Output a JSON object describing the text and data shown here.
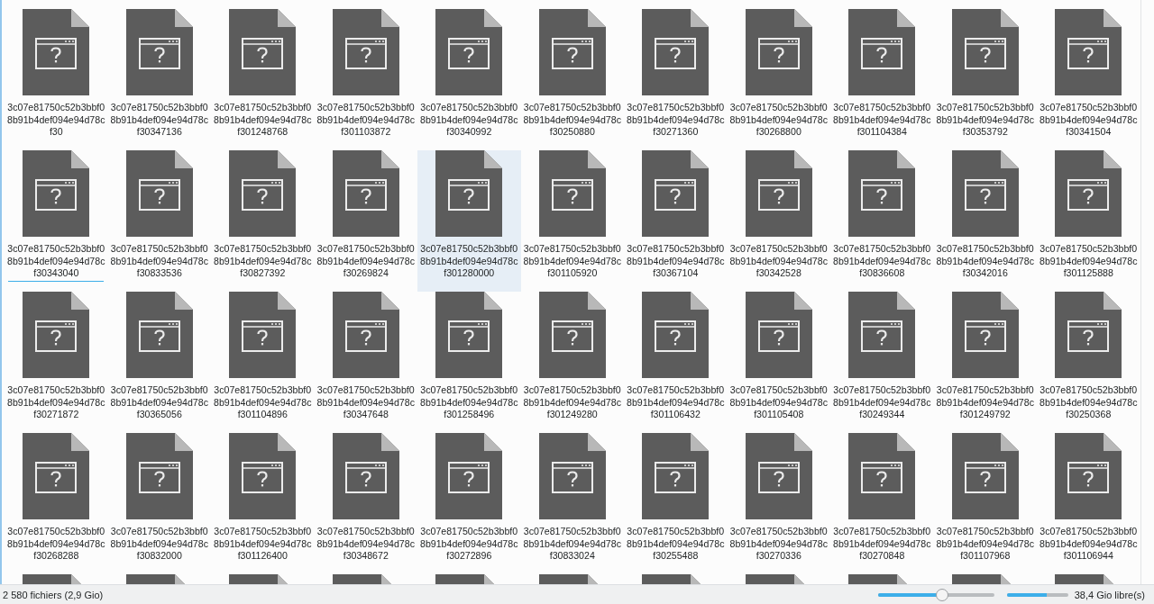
{
  "files": [
    {
      "kind": "file",
      "lines": [
        "3c07e81750c52b3bbf0",
        "8b91b4def094e94d78c",
        "f30"
      ],
      "focused": false,
      "hovered": false
    },
    {
      "kind": "file",
      "lines": [
        "3c07e81750c52b3bbf0",
        "8b91b4def094e94d78c",
        "f30347136"
      ],
      "focused": false,
      "hovered": false
    },
    {
      "kind": "file",
      "lines": [
        "3c07e81750c52b3bbf0",
        "8b91b4def094e94d78c",
        "f301248768"
      ],
      "focused": false,
      "hovered": false
    },
    {
      "kind": "file",
      "lines": [
        "3c07e81750c52b3bbf0",
        "8b91b4def094e94d78c",
        "f301103872"
      ],
      "focused": false,
      "hovered": false
    },
    {
      "kind": "file",
      "lines": [
        "3c07e81750c52b3bbf0",
        "8b91b4def094e94d78c",
        "f30340992"
      ],
      "focused": false,
      "hovered": false
    },
    {
      "kind": "file",
      "lines": [
        "3c07e81750c52b3bbf0",
        "8b91b4def094e94d78c",
        "f30250880"
      ],
      "focused": false,
      "hovered": false
    },
    {
      "kind": "file",
      "lines": [
        "3c07e81750c52b3bbf0",
        "8b91b4def094e94d78c",
        "f30271360"
      ],
      "focused": false,
      "hovered": false
    },
    {
      "kind": "file",
      "lines": [
        "3c07e81750c52b3bbf0",
        "8b91b4def094e94d78c",
        "f30268800"
      ],
      "focused": false,
      "hovered": false
    },
    {
      "kind": "file",
      "lines": [
        "3c07e81750c52b3bbf0",
        "8b91b4def094e94d78c",
        "f301104384"
      ],
      "focused": false,
      "hovered": false
    },
    {
      "kind": "file",
      "lines": [
        "3c07e81750c52b3bbf0",
        "8b91b4def094e94d78c",
        "f30353792"
      ],
      "focused": false,
      "hovered": false
    },
    {
      "kind": "file",
      "lines": [
        "3c07e81750c52b3bbf0",
        "8b91b4def094e94d78c",
        "f30341504"
      ],
      "focused": false,
      "hovered": false
    },
    {
      "kind": "file",
      "lines": [
        "3c07e81750c52b3bbf0",
        "8b91b4def094e94d78c",
        "f30343040"
      ],
      "focused": true,
      "hovered": false
    },
    {
      "kind": "file",
      "lines": [
        "3c07e81750c52b3bbf0",
        "8b91b4def094e94d78c",
        "f30833536"
      ],
      "focused": false,
      "hovered": false
    },
    {
      "kind": "file",
      "lines": [
        "3c07e81750c52b3bbf0",
        "8b91b4def094e94d78c",
        "f30827392"
      ],
      "focused": false,
      "hovered": false
    },
    {
      "kind": "file",
      "lines": [
        "3c07e81750c52b3bbf0",
        "8b91b4def094e94d78c",
        "f30269824"
      ],
      "focused": false,
      "hovered": false
    },
    {
      "kind": "file",
      "lines": [
        "3c07e81750c52b3bbf0",
        "8b91b4def094e94d78c",
        "f301280000"
      ],
      "focused": false,
      "hovered": true
    },
    {
      "kind": "file",
      "lines": [
        "3c07e81750c52b3bbf0",
        "8b91b4def094e94d78c",
        "f301105920"
      ],
      "focused": false,
      "hovered": false
    },
    {
      "kind": "file",
      "lines": [
        "3c07e81750c52b3bbf0",
        "8b91b4def094e94d78c",
        "f30367104"
      ],
      "focused": false,
      "hovered": false
    },
    {
      "kind": "file",
      "lines": [
        "3c07e81750c52b3bbf0",
        "8b91b4def094e94d78c",
        "f30342528"
      ],
      "focused": false,
      "hovered": false
    },
    {
      "kind": "file",
      "lines": [
        "3c07e81750c52b3bbf0",
        "8b91b4def094e94d78c",
        "f30836608"
      ],
      "focused": false,
      "hovered": false
    },
    {
      "kind": "file",
      "lines": [
        "3c07e81750c52b3bbf0",
        "8b91b4def094e94d78c",
        "f30342016"
      ],
      "focused": false,
      "hovered": false
    },
    {
      "kind": "file",
      "lines": [
        "3c07e81750c52b3bbf0",
        "8b91b4def094e94d78c",
        "f301125888"
      ],
      "focused": false,
      "hovered": false
    },
    {
      "kind": "file",
      "lines": [
        "3c07e81750c52b3bbf0",
        "8b91b4def094e94d78c",
        "f30271872"
      ],
      "focused": false,
      "hovered": false
    },
    {
      "kind": "file",
      "lines": [
        "3c07e81750c52b3bbf0",
        "8b91b4def094e94d78c",
        "f30365056"
      ],
      "focused": false,
      "hovered": false
    },
    {
      "kind": "file",
      "lines": [
        "3c07e81750c52b3bbf0",
        "8b91b4def094e94d78c",
        "f301104896"
      ],
      "focused": false,
      "hovered": false
    },
    {
      "kind": "file",
      "lines": [
        "3c07e81750c52b3bbf0",
        "8b91b4def094e94d78c",
        "f30347648"
      ],
      "focused": false,
      "hovered": false
    },
    {
      "kind": "file",
      "lines": [
        "3c07e81750c52b3bbf0",
        "8b91b4def094e94d78c",
        "f301258496"
      ],
      "focused": false,
      "hovered": false
    },
    {
      "kind": "file",
      "lines": [
        "3c07e81750c52b3bbf0",
        "8b91b4def094e94d78c",
        "f301249280"
      ],
      "focused": false,
      "hovered": false
    },
    {
      "kind": "file",
      "lines": [
        "3c07e81750c52b3bbf0",
        "8b91b4def094e94d78c",
        "f301106432"
      ],
      "focused": false,
      "hovered": false
    },
    {
      "kind": "file",
      "lines": [
        "3c07e81750c52b3bbf0",
        "8b91b4def094e94d78c",
        "f301105408"
      ],
      "focused": false,
      "hovered": false
    },
    {
      "kind": "file",
      "lines": [
        "3c07e81750c52b3bbf0",
        "8b91b4def094e94d78c",
        "f30249344"
      ],
      "focused": false,
      "hovered": false
    },
    {
      "kind": "file",
      "lines": [
        "3c07e81750c52b3bbf0",
        "8b91b4def094e94d78c",
        "f301249792"
      ],
      "focused": false,
      "hovered": false
    },
    {
      "kind": "file",
      "lines": [
        "3c07e81750c52b3bbf0",
        "8b91b4def094e94d78c",
        "f30250368"
      ],
      "focused": false,
      "hovered": false
    },
    {
      "kind": "file",
      "lines": [
        "3c07e81750c52b3bbf0",
        "8b91b4def094e94d78c",
        "f30268288"
      ],
      "focused": false,
      "hovered": false
    },
    {
      "kind": "file",
      "lines": [
        "3c07e81750c52b3bbf0",
        "8b91b4def094e94d78c",
        "f30832000"
      ],
      "focused": false,
      "hovered": false
    },
    {
      "kind": "file",
      "lines": [
        "3c07e81750c52b3bbf0",
        "8b91b4def094e94d78c",
        "f301126400"
      ],
      "focused": false,
      "hovered": false
    },
    {
      "kind": "file",
      "lines": [
        "3c07e81750c52b3bbf0",
        "8b91b4def094e94d78c",
        "f30348672"
      ],
      "focused": false,
      "hovered": false
    },
    {
      "kind": "file",
      "lines": [
        "3c07e81750c52b3bbf0",
        "8b91b4def094e94d78c",
        "f30272896"
      ],
      "focused": false,
      "hovered": false
    },
    {
      "kind": "file",
      "lines": [
        "3c07e81750c52b3bbf0",
        "8b91b4def094e94d78c",
        "f30833024"
      ],
      "focused": false,
      "hovered": false
    },
    {
      "kind": "file",
      "lines": [
        "3c07e81750c52b3bbf0",
        "8b91b4def094e94d78c",
        "f30255488"
      ],
      "focused": false,
      "hovered": false
    },
    {
      "kind": "file",
      "lines": [
        "3c07e81750c52b3bbf0",
        "8b91b4def094e94d78c",
        "f30270336"
      ],
      "focused": false,
      "hovered": false
    },
    {
      "kind": "file",
      "lines": [
        "3c07e81750c52b3bbf0",
        "8b91b4def094e94d78c",
        "f30270848"
      ],
      "focused": false,
      "hovered": false
    },
    {
      "kind": "file",
      "lines": [
        "3c07e81750c52b3bbf0",
        "8b91b4def094e94d78c",
        "f301107968"
      ],
      "focused": false,
      "hovered": false
    },
    {
      "kind": "file",
      "lines": [
        "3c07e81750c52b3bbf0",
        "8b91b4def094e94d78c",
        "f301106944"
      ],
      "focused": false,
      "hovered": false
    },
    {
      "kind": "cut"
    },
    {
      "kind": "cut"
    },
    {
      "kind": "cut"
    },
    {
      "kind": "cut"
    },
    {
      "kind": "cut"
    },
    {
      "kind": "cut"
    },
    {
      "kind": "cut"
    },
    {
      "kind": "cut"
    },
    {
      "kind": "cut"
    },
    {
      "kind": "cut"
    },
    {
      "kind": "cut"
    }
  ],
  "status_bar": {
    "count": "2 580 fichiers (2,9 Gio)",
    "zoom": {
      "level": 0.55
    },
    "disk": {
      "level": 0.65
    },
    "free": "38,4 Gio libre(s)"
  }
}
